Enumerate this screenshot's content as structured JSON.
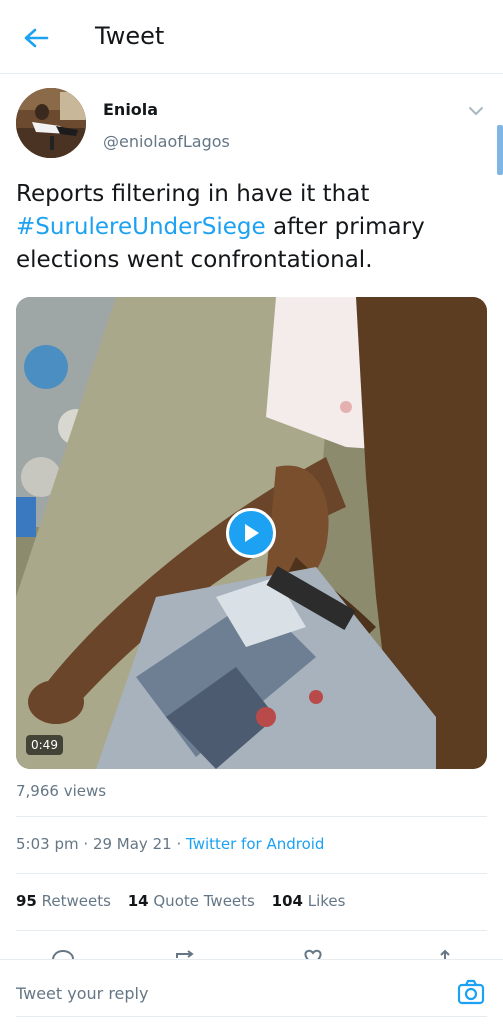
{
  "header": {
    "title": "Tweet",
    "back_icon": "arrow-left-icon"
  },
  "tweet": {
    "author_name": "Eniola",
    "author_handle": "@eniolaofLagos",
    "text_before": "Reports filtering in have it that ",
    "hashtag": "#SurulereUnderSiege",
    "text_after": " after primary elections went confrontational.",
    "media": {
      "duration": "0:49",
      "play_icon": "play-icon"
    },
    "views": "7,966 views",
    "time": "5:03 pm",
    "date": "29 May 21",
    "source": "Twitter for Android",
    "separator": "·",
    "stats": {
      "retweets_count": "95",
      "retweets_label": "Retweets",
      "quotes_count": "14",
      "quotes_label": "Quote Tweets",
      "likes_count": "104",
      "likes_label": "Likes"
    }
  },
  "reply": {
    "placeholder": "Tweet your reply",
    "camera_icon": "camera-icon"
  },
  "colors": {
    "accent": "#1da1f2",
    "text": "#14171a",
    "muted": "#657786",
    "divider": "#e6ecf0"
  }
}
